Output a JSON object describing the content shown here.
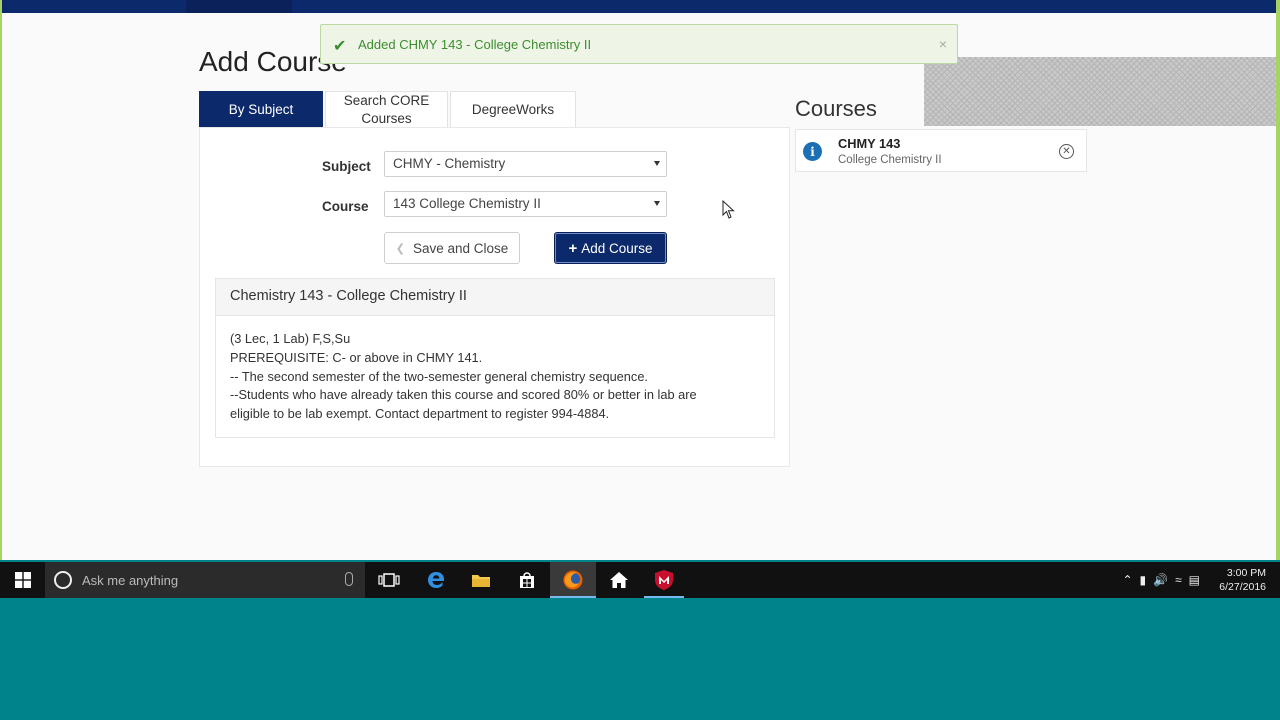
{
  "page": {
    "title": "Add Course"
  },
  "tabs": [
    {
      "label": "By Subject",
      "active": true
    },
    {
      "label": "Search CORE Courses",
      "active": false
    },
    {
      "label": "DegreeWorks",
      "active": false
    }
  ],
  "form": {
    "subject_label": "Subject",
    "subject_value": "CHMY - Chemistry",
    "course_label": "Course",
    "course_value": "143 College Chemistry II",
    "save_label": "Save and Close",
    "add_label": "Add Course"
  },
  "course_detail": {
    "heading": "Chemistry 143 - College Chemistry II",
    "lines": [
      "(3 Lec, 1 Lab) F,S,Su",
      "PREREQUISITE: C- or above in CHMY 141.",
      "-- The second semester of the two-semester general chemistry sequence.",
      "--Students who have already taken this course and scored 80% or better in lab are",
      "eligible to be lab exempt.  Contact department to register 994-4884."
    ]
  },
  "courses_panel": {
    "title": "Courses",
    "items": [
      {
        "code": "CHMY 143",
        "name": "College Chemistry II"
      }
    ]
  },
  "toast": {
    "message": "Added CHMY 143 - College Chemistry II",
    "close": "×"
  },
  "taskbar": {
    "search_placeholder": "Ask me anything",
    "time": "3:00 PM",
    "date": "6/27/2016"
  },
  "colors": {
    "primary": "#0c2a6b",
    "success": "#3c8d2f",
    "taskbar": "#111111",
    "desktop": "#00838a"
  }
}
